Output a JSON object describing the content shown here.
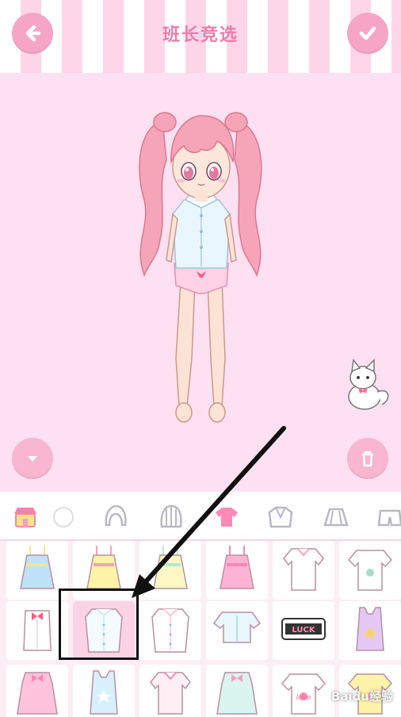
{
  "header": {
    "title": "班长竞选",
    "back_icon": "arrow-left-icon",
    "confirm_icon": "check-icon"
  },
  "stage": {
    "toggle_icon": "chevron-down-icon",
    "trash_icon": "trash-icon"
  },
  "categories": [
    {
      "name": "background",
      "icon": "shop-icon",
      "selected": false
    },
    {
      "name": "face",
      "icon": "face-icon",
      "selected": false
    },
    {
      "name": "hair",
      "icon": "hair-icon",
      "selected": false
    },
    {
      "name": "hair-back",
      "icon": "hair-back-icon",
      "selected": false
    },
    {
      "name": "tops",
      "icon": "shirt-icon",
      "selected": true
    },
    {
      "name": "jackets",
      "icon": "jacket-icon",
      "selected": false
    },
    {
      "name": "skirts",
      "icon": "skirt-icon",
      "selected": false
    },
    {
      "name": "pants",
      "icon": "pants-icon",
      "selected": false
    }
  ],
  "items": [
    {
      "kind": "camisole",
      "color": "#bfe2f7",
      "accent": "#ffe48a"
    },
    {
      "kind": "camisole",
      "color": "#fff3a8",
      "accent": "#ff9cc0"
    },
    {
      "kind": "camisole",
      "color": "#fff7c4",
      "accent": "#b9e7d3"
    },
    {
      "kind": "camisole",
      "color": "#ffb3d4",
      "accent": "#ff86b4"
    },
    {
      "kind": "blouse",
      "color": "#ffffff",
      "accent": "#ff9cc0"
    },
    {
      "kind": "tee",
      "color": "#ffffff",
      "accent": "#a9dcc8"
    },
    {
      "kind": "bowshirt",
      "color": "#ffffff",
      "accent": "#ff5a7a"
    },
    {
      "kind": "shirt",
      "color": "#f4fbff",
      "accent": "#cfe6f5",
      "selected": true
    },
    {
      "kind": "shirt",
      "color": "#ffffff",
      "accent": "#ffc7dc"
    },
    {
      "kind": "cropshirt",
      "color": "#e9f7ff",
      "accent": "#9fd3ee"
    },
    {
      "kind": "crop",
      "color": "#ffffff",
      "accent": "#ff8ab5"
    },
    {
      "kind": "tank",
      "color": "#e6c8f5",
      "accent": "#f7d56a"
    },
    {
      "kind": "dress",
      "color": "#ffc3dd",
      "accent": "#ff86b4"
    },
    {
      "kind": "tank",
      "color": "#d8f0fb",
      "accent": "#ffffff"
    },
    {
      "kind": "blouse",
      "color": "#fff0f6",
      "accent": "#ff86b4"
    },
    {
      "kind": "dress",
      "color": "#d9f5ee",
      "accent": "#ff9cc0"
    },
    {
      "kind": "tee",
      "color": "#ffffff",
      "accent": "#ff86b4"
    },
    {
      "kind": "tee",
      "color": "#fff3a8",
      "accent": "#ffb0cf"
    }
  ],
  "item_texts": {
    "luck_label": "LUCK",
    "love_label": "love"
  },
  "watermark": "Baidu经验"
}
